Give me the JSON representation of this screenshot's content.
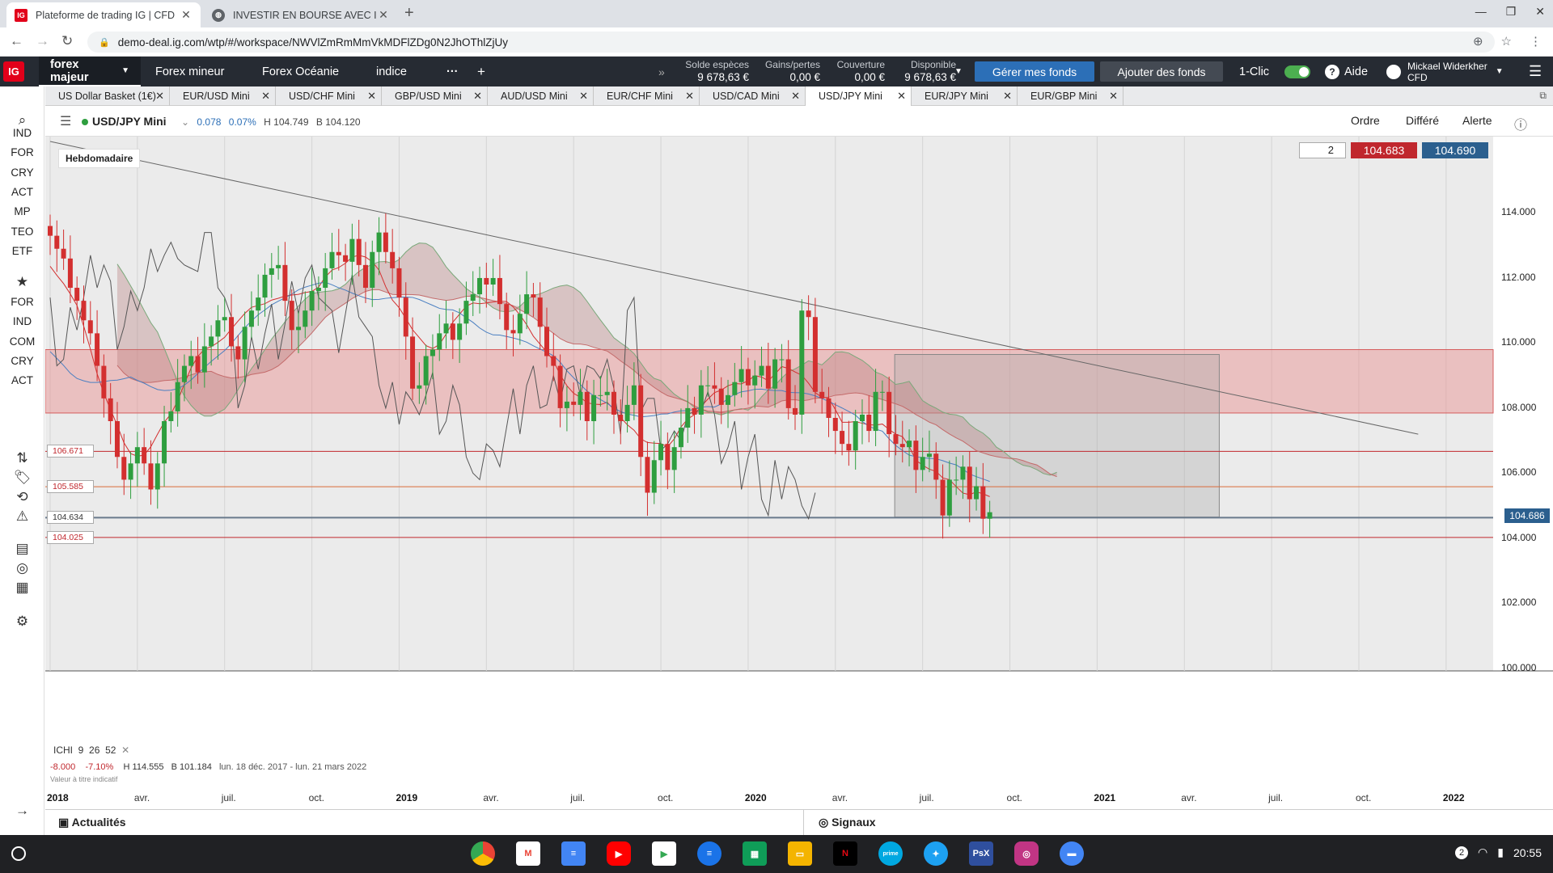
{
  "browser": {
    "tabs": [
      {
        "title": "Plateforme de trading IG | CFD",
        "active": true
      },
      {
        "title": "INVESTIR EN BOURSE AVEC ICH",
        "active": false
      }
    ],
    "url": "demo-deal.ig.com/wtp/#/workspace/NWVlZmRmMmVkMDFlZDg0N2JhOThlZjUy"
  },
  "ig": {
    "logo": "IG",
    "nav_tabs": [
      "forex majeur",
      "Forex mineur",
      "Forex Océanie",
      "indice"
    ],
    "more_label": "···",
    "add_label": "+",
    "account": [
      {
        "label": "Solde espèces",
        "value": "9 678,63 €"
      },
      {
        "label": "Gains/pertes",
        "value": "0,00 €"
      },
      {
        "label": "Couverture",
        "value": "0,00 €"
      },
      {
        "label": "Disponible",
        "value": "9 678,63 €"
      }
    ],
    "manage_funds": "Gérer mes fonds",
    "add_funds": "Ajouter des fonds",
    "one_click": "1-Clic",
    "help": "Aide",
    "user_name": "Mickael Widerkher",
    "user_type": "CFD"
  },
  "instrument_tabs": [
    "US Dollar Basket (1€)",
    "EUR/USD Mini",
    "USD/CHF Mini",
    "GBP/USD Mini",
    "AUD/USD Mini",
    "EUR/CHF Mini",
    "USD/CAD Mini",
    "USD/JPY Mini",
    "EUR/JPY Mini",
    "EUR/GBP Mini"
  ],
  "active_instrument_tab": 7,
  "sidebar": {
    "group1": [
      "IND",
      "FOR",
      "CRY",
      "ACT",
      "MP",
      "TEO",
      "ETF"
    ],
    "group2": [
      "FOR",
      "IND",
      "COM",
      "CRY",
      "ACT"
    ]
  },
  "chart_header": {
    "instrument": "USD/JPY Mini",
    "change": "0.078",
    "change_pct": "0.07%",
    "high": "H 104.749",
    "low": "B 104.120",
    "order": "Ordre",
    "deferred": "Différé",
    "alert": "Alerte"
  },
  "chart": {
    "period_label": "Hebdomadaire",
    "quantity": "2",
    "sell_price": "104.683",
    "buy_price": "104.690",
    "current_price": "104.686",
    "level_labels": [
      "106.671",
      "105.585",
      "104.634",
      "104.025"
    ],
    "ichimoku_label": "ICHI",
    "ichimoku_params": [
      "9",
      "26",
      "52"
    ],
    "stats": {
      "change": "-8.000",
      "change_pct": "-7.10%",
      "high": "H 114.555",
      "low": "B 101.184",
      "range": "lun. 18 déc. 2017 - lun. 21 mars 2022"
    },
    "note": "Valeur à titre indicatif",
    "colors": {
      "up": "#2e9e3f",
      "down": "#d32f2f",
      "zone": "#e8a6a6",
      "box": "#9e9e9e",
      "kumo_bull": "#a8cfa8",
      "kumo_bear": "#e5a0a0"
    }
  },
  "chart_data": {
    "type": "candlestick",
    "instrument": "USD/JPY Mini",
    "timeframe": "Hebdomadaire",
    "y_ticks": [
      114.0,
      112.0,
      110.0,
      108.0,
      106.0,
      104.0,
      102.0,
      100.0
    ],
    "ylim": [
      99.2,
      116.0
    ],
    "x_ticks": [
      "2018",
      "avr.",
      "juil.",
      "oct.",
      "2019",
      "avr.",
      "juil.",
      "oct.",
      "2020",
      "avr.",
      "juil.",
      "oct.",
      "2021",
      "avr.",
      "juil.",
      "oct.",
      "2022"
    ],
    "horizontal_levels": [
      106.671,
      105.585,
      104.634,
      104.025
    ],
    "resistance_zone": [
      107.85,
      109.8
    ],
    "trendline": [
      {
        "x": "2018",
        "y": 116.2
      },
      {
        "x": "2021-12",
        "y": 107.2
      }
    ],
    "closes": [
      113.3,
      112.9,
      112.6,
      111.7,
      111.3,
      110.7,
      110.3,
      109.3,
      108.3,
      107.6,
      106.5,
      105.8,
      106.3,
      106.8,
      106.3,
      105.5,
      106.3,
      107.6,
      107.9,
      108.8,
      109.3,
      109.6,
      109.1,
      109.9,
      110.2,
      110.7,
      110.8,
      109.9,
      109.5,
      110.5,
      111.0,
      111.4,
      112.1,
      112.3,
      112.4,
      111.3,
      110.4,
      110.5,
      111.0,
      111.6,
      111.7,
      112.3,
      112.8,
      112.7,
      112.5,
      113.2,
      112.4,
      111.7,
      112.8,
      113.4,
      112.8,
      112.3,
      111.4,
      110.2,
      108.6,
      108.7,
      109.6,
      109.8,
      110.3,
      110.6,
      110.1,
      110.6,
      111.3,
      111.5,
      112.0,
      111.8,
      112.0,
      111.2,
      110.4,
      110.3,
      110.9,
      111.5,
      111.4,
      110.5,
      109.6,
      109.3,
      108.0,
      108.2,
      108.1,
      108.5,
      107.6,
      108.4,
      108.4,
      108.5,
      107.8,
      107.6,
      108.1,
      108.7,
      106.5,
      105.4,
      106.4,
      106.9,
      106.1,
      106.8,
      107.4,
      108.0,
      107.8,
      108.7,
      108.7,
      108.6,
      108.1,
      108.4,
      108.8,
      109.2,
      108.7,
      109.0,
      109.3,
      108.6,
      109.5,
      109.5,
      108.0,
      107.8,
      111.0,
      110.8,
      108.5,
      108.3,
      107.7,
      107.3,
      106.9,
      106.7,
      107.6,
      107.8,
      107.3,
      108.5,
      108.5,
      107.2,
      106.9,
      106.8,
      107.0,
      106.1,
      106.5,
      106.6,
      105.8,
      104.7,
      105.8,
      105.8,
      106.2,
      105.2,
      105.6,
      104.6,
      104.8
    ]
  },
  "bottom": {
    "news": "Actualités",
    "signals": "Signaux"
  },
  "shelf": {
    "time": "20:55",
    "notifications": "2"
  }
}
